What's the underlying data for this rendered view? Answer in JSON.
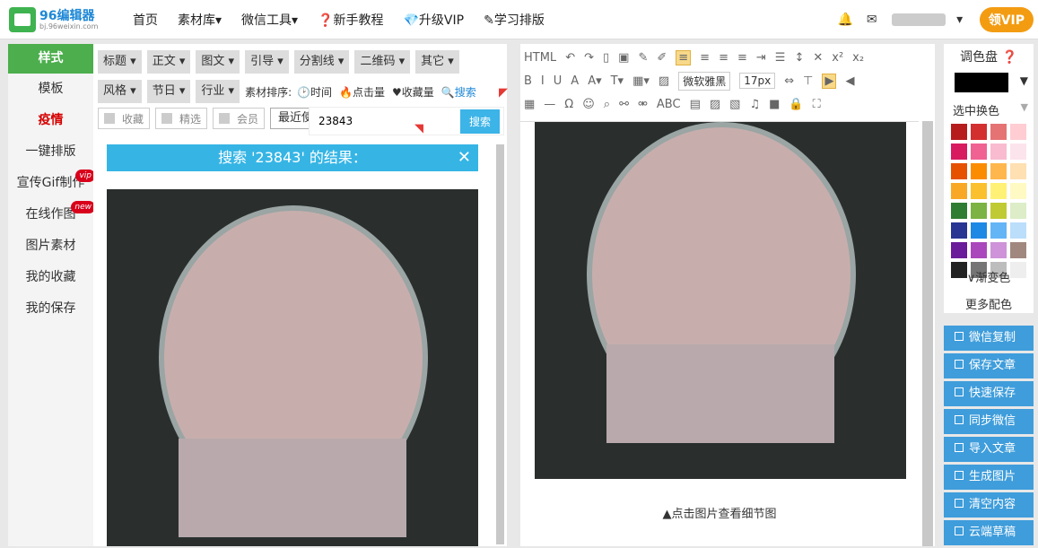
{
  "logo": {
    "name": "96编辑器",
    "url": "bj.96weixin.com"
  },
  "nav": [
    "首页",
    "素材库▾",
    "微信工具▾",
    "❓新手教程",
    "💎升级VIP",
    "✎学习排版"
  ],
  "topright": {
    "vip": "领VIP"
  },
  "leftnav": [
    {
      "label": "样式"
    },
    {
      "label": "模板"
    },
    {
      "label": "疫情"
    },
    {
      "label": "一键排版"
    },
    {
      "label": "宣传Gif制作",
      "badge": "vip"
    },
    {
      "label": "在线作图",
      "badge": "new"
    },
    {
      "label": "图片素材"
    },
    {
      "label": "我的收藏"
    },
    {
      "label": "我的保存"
    }
  ],
  "filters1": [
    "标题",
    "正文",
    "图文",
    "引导",
    "分割线",
    "二维码",
    "其它"
  ],
  "filters2": [
    "风格",
    "节日",
    "行业"
  ],
  "sort": {
    "label": "素材排序:",
    "items": [
      "🕑时间",
      "🔥点击量",
      "♥收藏量"
    ],
    "search": "🔍搜索"
  },
  "checks": [
    "收藏",
    "精选",
    "会员"
  ],
  "recent": "最近使",
  "search": {
    "value": "23843",
    "button": "搜索"
  },
  "result": {
    "title": "搜索 '23843' 的结果：",
    "close": "✕"
  },
  "editor": {
    "font": "微软雅黑",
    "size": "17px",
    "caption": "▲点击图片查看细节图"
  },
  "palette": {
    "title": "调色盘 ❓",
    "select_label": "选中换色",
    "gradient": "∨渐变色",
    "more": "更多配色",
    "colors": [
      "#b71c1c",
      "#d32f2f",
      "#e57373",
      "#ffcdd2",
      "#d81b60",
      "#f06292",
      "#f8bbd0",
      "#fce4ec",
      "#e65100",
      "#fb8c00",
      "#ffb74d",
      "#ffe0b2",
      "#f9a825",
      "#fbc02d",
      "#fff176",
      "#fff9c4",
      "#2e7d32",
      "#7cb342",
      "#c0ca33",
      "#dcedc8",
      "#283593",
      "#1e88e5",
      "#64b5f6",
      "#bbdefb",
      "#6a1b9a",
      "#ab47bc",
      "#ce93d8",
      "#a1887f",
      "#222222",
      "#757575",
      "#bdbdbd",
      "#eeeeee"
    ]
  },
  "actions": [
    "微信复制",
    "保存文章",
    "快速保存",
    "同步微信",
    "导入文章",
    "生成图片",
    "清空内容",
    "云端草稿"
  ]
}
